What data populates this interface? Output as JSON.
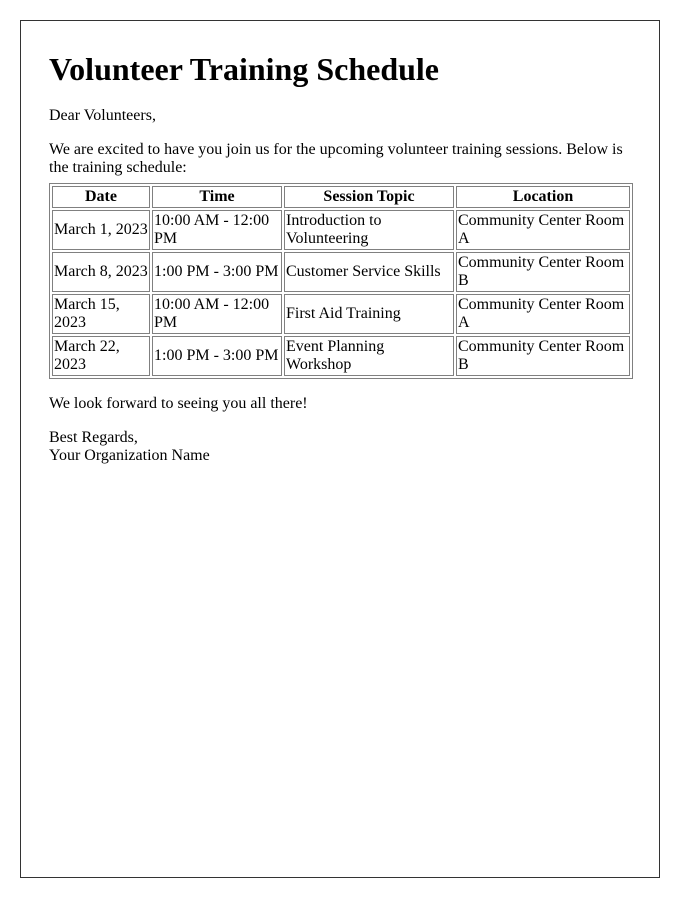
{
  "title": "Volunteer Training Schedule",
  "greeting": "Dear Volunteers,",
  "intro": "We are excited to have you join us for the upcoming volunteer training sessions. Below is the training schedule:",
  "table": {
    "headers": [
      "Date",
      "Time",
      "Session Topic",
      "Location"
    ],
    "rows": [
      [
        "March 1, 2023",
        "10:00 AM - 12:00 PM",
        "Introduction to Volunteering",
        "Community Center Room A"
      ],
      [
        "March 8, 2023",
        "1:00 PM - 3:00 PM",
        "Customer Service Skills",
        "Community Center Room B"
      ],
      [
        "March 15, 2023",
        "10:00 AM - 12:00 PM",
        "First Aid Training",
        "Community Center Room A"
      ],
      [
        "March 22, 2023",
        "1:00 PM - 3:00 PM",
        "Event Planning Workshop",
        "Community Center Room B"
      ]
    ]
  },
  "closing": "We look forward to seeing you all there!",
  "signoff": "Best Regards,",
  "organization": "Your Organization Name"
}
